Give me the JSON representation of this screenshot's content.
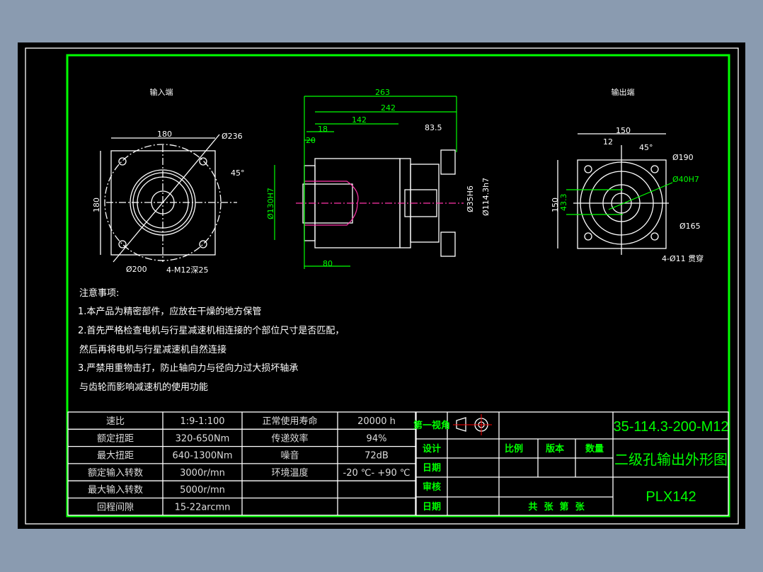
{
  "colors": {
    "background": "#8a9bb0",
    "canvas": "#000000",
    "frame": "#00ff00",
    "lines": "#ffffff",
    "centerline": "#ff33aa"
  },
  "views": {
    "input": {
      "title": "输入端",
      "dims": {
        "width": "180",
        "height": "180",
        "d_outer": "Ø236",
        "d_pcd": "Ø200",
        "angle": "45°",
        "holes": "4-M12深25"
      }
    },
    "side": {
      "dims": {
        "total": "263",
        "d242": "242",
        "d142": "142",
        "d18": "18",
        "d20": "20",
        "d83": "83.5",
        "d80": "80",
        "d_input": "Ø130H7",
        "d_bore": "Ø35H6",
        "d_output": "Ø114.3h7"
      }
    },
    "output": {
      "title": "输出端",
      "dims": {
        "width": "150",
        "height": "150",
        "key": "12",
        "angle": "45°",
        "d190": "Ø190",
        "d40": "Ø40H7",
        "d165": "Ø165",
        "d43": "43.3",
        "holes": "4-Ø11 贯穿"
      }
    }
  },
  "notes": {
    "title": "注意事项:",
    "lines": [
      "1.本产品为精密部件，应放在干燥的地方保管",
      "2.首先严格检查电机与行星减速机相连接的个部位尺寸是否匹配，",
      "然后再将电机与行星减速机自然连接",
      "3.严禁用重物击打，防止轴向力与径向力过大损坏轴承",
      "与齿轮而影响减速机的使用功能"
    ]
  },
  "spec_table": {
    "rows": [
      [
        "速比",
        "1:9-1:100",
        "正常使用寿命",
        "20000 h"
      ],
      [
        "额定扭距",
        "320-650Nm",
        "传递效率",
        "94%"
      ],
      [
        "最大扭距",
        "640-1300Nm",
        "噪音",
        "72dB"
      ],
      [
        "额定输入转数",
        "3000r/mn",
        "环境温度",
        "-20 ℃- +90 ℃"
      ],
      [
        "最大输入转数",
        "5000r/mn",
        "",
        ""
      ],
      [
        "回程间隙",
        "15-22arcmn",
        "",
        ""
      ]
    ]
  },
  "title_block": {
    "projection": "第一视角",
    "design": "设计",
    "date1": "日期",
    "review": "审核",
    "date2": "日期",
    "scale": "比例",
    "version": "版本",
    "quantity": "数量",
    "sheets": "共  张  第  张",
    "drawing_no": "35-114.3-200-M12",
    "drawing_name": "二级孔输出外形图",
    "model": "PLX142"
  }
}
